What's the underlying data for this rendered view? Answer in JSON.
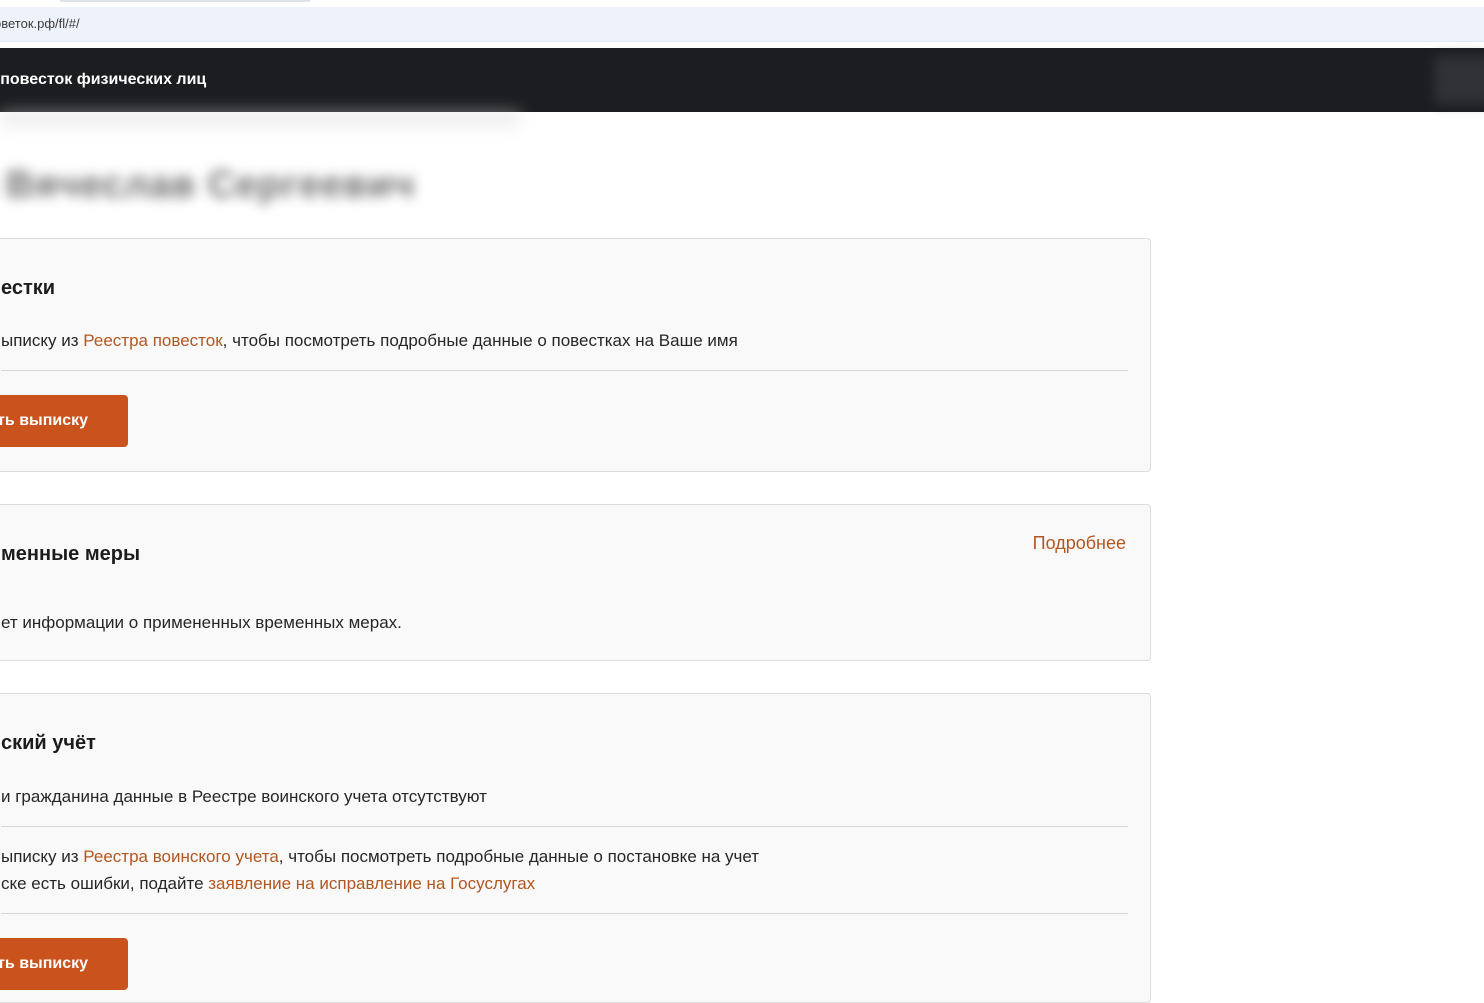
{
  "browser": {
    "url": "оветок.рф/fl/#/"
  },
  "header": {
    "title": "о повесток физических лиц"
  },
  "user": {
    "name": "в Вячеслав Сергеевич"
  },
  "summons": {
    "title": "естки",
    "text_prefix": "ыписку из ",
    "link": "Реестра повесток",
    "text_suffix": ", чтобы посмотреть подробные данные о повестках на Ваше имя",
    "button": "ть выписку"
  },
  "measures": {
    "title": "менные меры",
    "more": "Подробнее",
    "text": "ет информации о примененных временных мерах."
  },
  "military": {
    "title": "ский учёт",
    "status": "и гражданина данные в Реестре воинского учета отсутствуют",
    "line1_prefix": "ыписку из ",
    "line1_link": "Реестра воинского учета",
    "line1_suffix": ",  чтобы посмотреть подробные данные о постановке на учет",
    "line2_prefix": "ске есть ошибки, подайте ",
    "line2_link": "заявление на исправление на Госуслугах",
    "button": "ть выписку"
  }
}
